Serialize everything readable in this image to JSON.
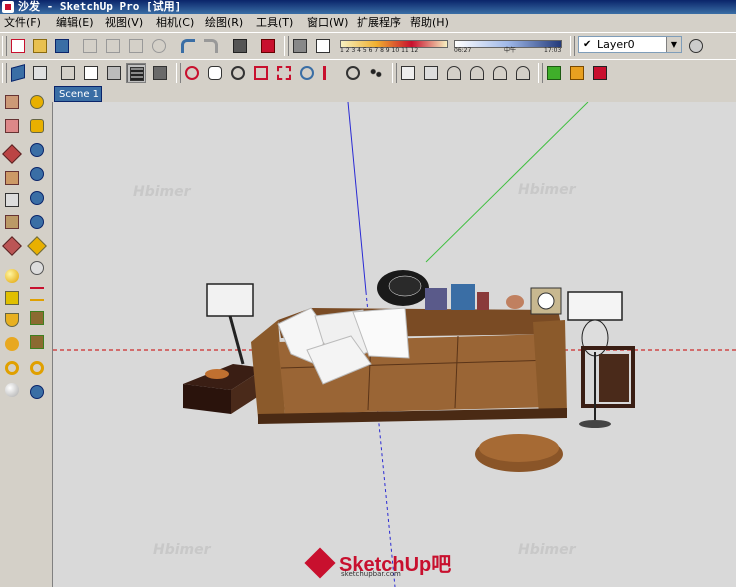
{
  "window": {
    "title": "沙发 - SketchUp Pro [试用]"
  },
  "menu": [
    "文件(F)",
    "编辑(E)",
    "视图(V)",
    "相机(C)",
    "绘图(R)",
    "工具(T)",
    "窗口(W)",
    "扩展程序",
    "帮助(H)"
  ],
  "toolbar_row1": {
    "buttons": [
      "new-file",
      "open-file",
      "save-file",
      "cut",
      "copy",
      "paste",
      "erase",
      "undo",
      "redo",
      "print",
      "model-info"
    ],
    "shadow_months": "1 2 3 4 5 6 7 8 9 10 11 12",
    "shadow_time_start": "06:27",
    "shadow_time_mid": "中午",
    "shadow_time_end": "17:03",
    "layer_value": "Layer0"
  },
  "toolbar_row2": {
    "buttons": [
      "iso-view",
      "top-view",
      "xray",
      "wireframe",
      "hidden-line",
      "shaded",
      "shaded-textures",
      "monochrome",
      "orbit",
      "pan",
      "zoom",
      "zoom-window",
      "zoom-extents",
      "previous-view",
      "position-camera",
      "look-around",
      "walk",
      "iso",
      "top",
      "front",
      "right",
      "back",
      "left",
      "get-models",
      "share-model",
      "extension-warehouse"
    ],
    "active": "shaded-textures"
  },
  "left_tools": [
    "select",
    "eraser",
    "paint-bucket",
    "line",
    "arc",
    "rectangle",
    "circle",
    "polygon",
    "move",
    "push-pull",
    "rotate",
    "follow-me",
    "scale",
    "offset",
    "tape-measure",
    "dimension",
    "protractor",
    "text",
    "axes",
    "3d-text",
    "section-plane",
    "walk-person",
    "orbit-left",
    "zoom-left",
    "sandbox",
    "layer-m",
    "component-r",
    "rt",
    "br",
    "question-tool",
    "look-tool",
    "add-location"
  ],
  "scene_tab": "Scene 1",
  "viewport": {
    "watermark": "Hbimer",
    "brand_name": "SketchUp吧",
    "brand_url": "sketchupbar.com",
    "colors": {
      "background": "#d9d9d9",
      "red_axis": "#cc0000",
      "green_axis": "#3fbf3f",
      "blue_axis": "#2a2ad4",
      "sofa": "#8b5a2b",
      "accent": "#c8102e"
    }
  }
}
